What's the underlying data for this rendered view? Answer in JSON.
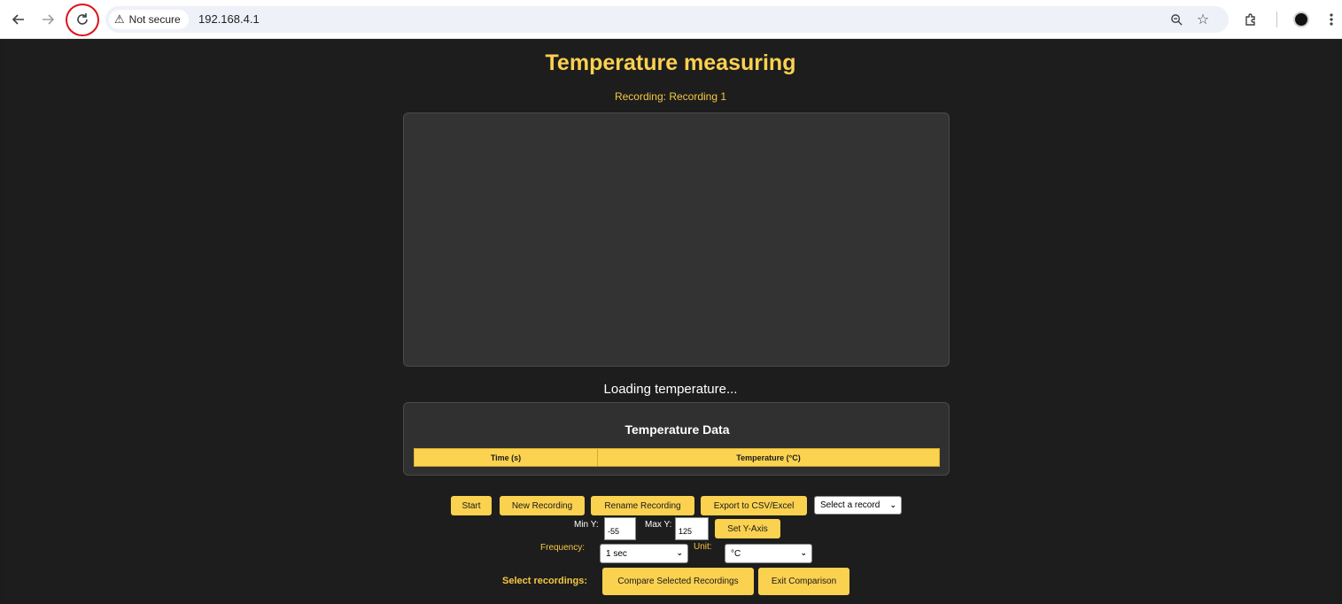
{
  "browser": {
    "security_label": "Not secure",
    "url": "192.168.4.1",
    "icons": [
      "back-arrow-icon",
      "forward-arrow-icon",
      "reload-icon",
      "warning-icon",
      "zoom-icon",
      "star-icon",
      "extensions-icon",
      "profile-icon",
      "menu-icon"
    ]
  },
  "header": {
    "title": "Temperature measuring",
    "recording_label": "Recording: Recording 1"
  },
  "status": {
    "loading_text": "Loading temperature..."
  },
  "data_panel": {
    "title": "Temperature Data",
    "columns": [
      "Time (s)",
      "Temperature (°C)"
    ]
  },
  "controls": {
    "start_label": "Start",
    "new_recording_label": "New Recording",
    "rename_recording_label": "Rename Recording",
    "export_label": "Export to CSV/Excel",
    "record_select_value": "Select a record",
    "min_y_label": "Min Y:",
    "min_y_value": "-55",
    "max_y_label": "Max Y:",
    "max_y_value": "125",
    "set_y_axis_label": "Set Y-Axis",
    "frequency_label": "Frequency:",
    "frequency_value": "1 sec",
    "unit_label": "Unit:",
    "unit_value": "°C",
    "select_recordings_label": "Select recordings:",
    "compare_label": "Compare Selected Recordings",
    "exit_comparison_label": "Exit Comparison"
  },
  "colors": {
    "accent": "#fbd150",
    "background": "#1d1d1d",
    "panel": "#333333",
    "highlight_ring": "#d9141b"
  }
}
